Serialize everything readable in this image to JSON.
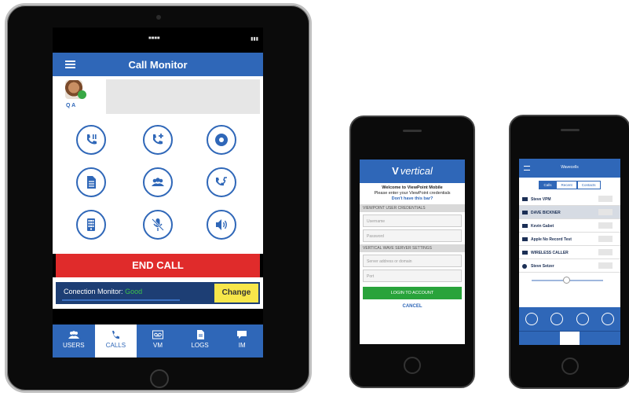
{
  "ipad": {
    "header": {
      "title": "Call Monitor"
    },
    "contact": {
      "name": "Q A"
    },
    "call_buttons": [
      {
        "name": "hold-call-icon"
      },
      {
        "name": "add-call-icon"
      },
      {
        "name": "record-icon"
      },
      {
        "name": "notes-icon"
      },
      {
        "name": "conference-icon"
      },
      {
        "name": "transfer-icon"
      },
      {
        "name": "keypad-icon"
      },
      {
        "name": "mute-icon"
      },
      {
        "name": "speaker-icon"
      }
    ],
    "end_call_label": "END CALL",
    "monitor": {
      "label": "Conection Monitor:",
      "status": "Good",
      "status_color": "#3cc24a",
      "change_label": "Change"
    },
    "tabs": [
      {
        "label": "USERS",
        "icon": "users-icon"
      },
      {
        "label": "CALLS",
        "icon": "phone-icon"
      },
      {
        "label": "VM",
        "icon": "voicemail-icon"
      },
      {
        "label": "LOGS",
        "icon": "logs-icon"
      },
      {
        "label": "IM",
        "icon": "chat-icon"
      }
    ],
    "active_tab": "CALLS"
  },
  "phone_login": {
    "logo": "vertical",
    "welcome_line1": "Welcome to ViewPoint Mobile",
    "welcome_line2": "Please enter your ViewPoint credentials",
    "welcome_link": "Don't have this bar?",
    "section_user": "VIEWPOINT USER CREDENTIALS",
    "username_placeholder": "Username",
    "password_placeholder": "Password",
    "section_server": "VERTICAL WAVE SERVER SETTINGS",
    "server_placeholder": "Server address or domain",
    "port_placeholder": "Port",
    "login_label": "LOGIN TO ACCOUNT",
    "cancel_label": "CANCEL"
  },
  "phone_list": {
    "title": "Wavecells",
    "segments": [
      "Calls",
      "Recent",
      "Contacts"
    ],
    "rows": [
      {
        "name": "Steve VPM"
      },
      {
        "name": "DAVE BICKNER"
      },
      {
        "name": "Kevin Gabet"
      },
      {
        "name": "Apple No Record Test"
      },
      {
        "name": "WIRELESS CALLER"
      },
      {
        "name": "Steve Setzer"
      }
    ],
    "highlighted_row": 1
  },
  "colors": {
    "brand_blue": "#2f67b8",
    "end_call_red": "#e02b2b",
    "change_yellow": "#f7e64a",
    "login_green": "#29a33b"
  }
}
